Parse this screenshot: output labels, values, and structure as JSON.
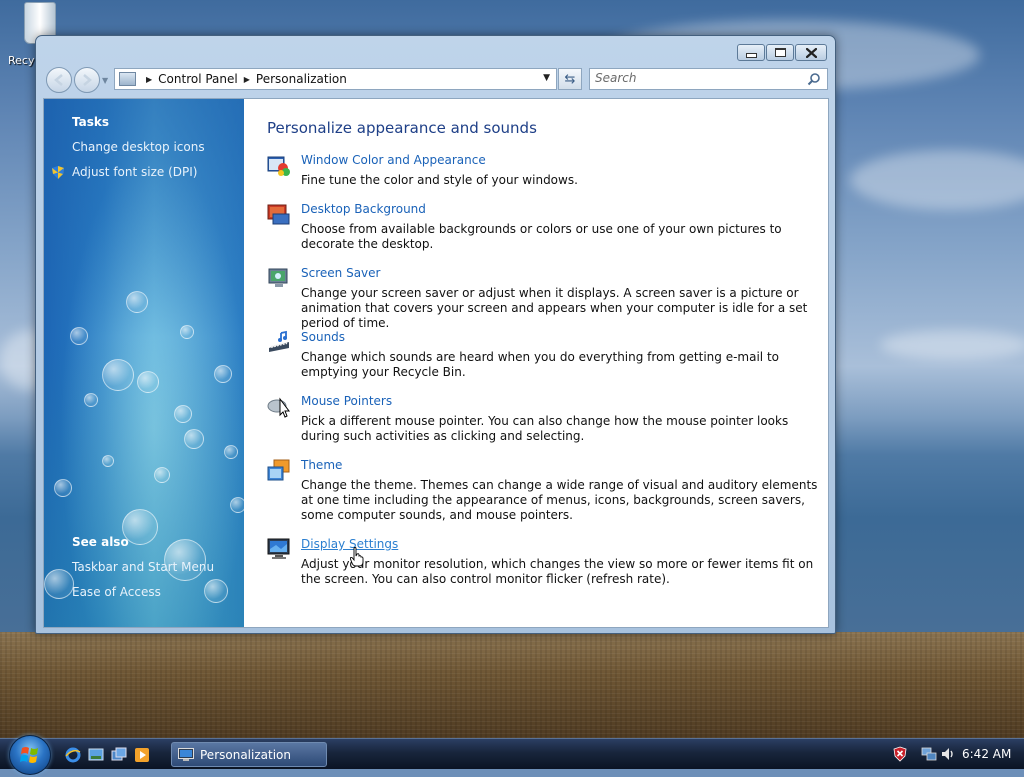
{
  "desktop": {
    "recycle_bin_label": "Recy"
  },
  "window": {
    "address": {
      "crumbs": [
        "Control Panel",
        "Personalization"
      ]
    },
    "search_placeholder": "Search",
    "sidebar": {
      "tasks_heading": "Tasks",
      "tasks": [
        "Change desktop icons",
        "Adjust font size (DPI)"
      ],
      "see_also_heading": "See also",
      "see_also": [
        "Taskbar and Start Menu",
        "Ease of Access"
      ]
    },
    "main": {
      "title": "Personalize appearance and sounds",
      "items": [
        {
          "link": "Window Color and Appearance",
          "desc": "Fine tune the color and style of your windows.",
          "icon": "window-color-icon"
        },
        {
          "link": "Desktop Background",
          "desc": "Choose from available backgrounds or colors or use one of your own pictures to decorate the desktop.",
          "icon": "desktop-background-icon"
        },
        {
          "link": "Screen Saver",
          "desc": "Change your screen saver or adjust when it displays. A screen saver is a picture or animation that covers your screen and appears when your computer is idle for a set period of time.",
          "icon": "screen-saver-icon"
        },
        {
          "link": "Sounds",
          "desc": "Change which sounds are heard when you do everything from getting e-mail to emptying your Recycle Bin.",
          "icon": "sounds-icon"
        },
        {
          "link": "Mouse Pointers",
          "desc": "Pick a different mouse pointer. You can also change how the mouse pointer looks during such activities as clicking and selecting.",
          "icon": "mouse-pointers-icon"
        },
        {
          "link": "Theme",
          "desc": "Change the theme. Themes can change a wide range of visual and auditory elements at one time including the appearance of menus, icons, backgrounds, screen savers, some computer sounds, and mouse pointers.",
          "icon": "theme-icon"
        },
        {
          "link": "Display Settings",
          "desc": "Adjust your monitor resolution, which changes the view so more or fewer items fit on the screen. You can also control monitor flicker (refresh rate).",
          "icon": "display-settings-icon"
        }
      ]
    }
  },
  "taskbar": {
    "task_button_label": "Personalization",
    "clock": "6:42 AM"
  }
}
